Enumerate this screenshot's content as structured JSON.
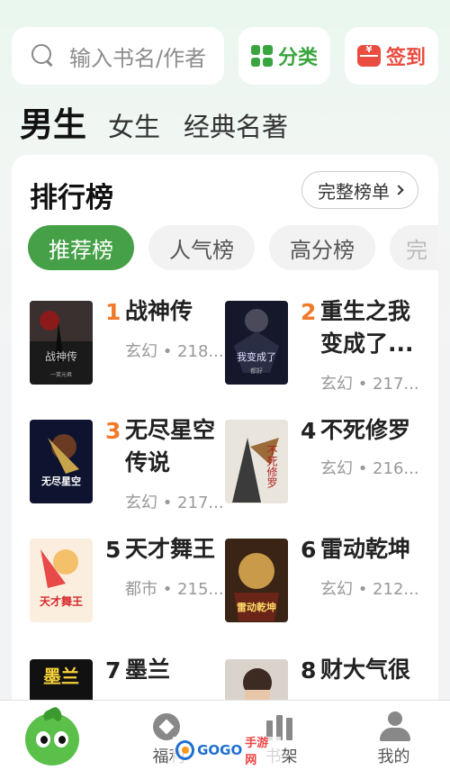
{
  "search": {
    "placeholder": "输入书名/作者"
  },
  "topbar": {
    "category_label": "分类",
    "signin_label": "签到",
    "signin_icon_glyph": "¥"
  },
  "categories": [
    {
      "label": "男生",
      "active": true
    },
    {
      "label": "女生",
      "active": false
    },
    {
      "label": "经典名著",
      "active": false
    }
  ],
  "rankings": {
    "title": "排行榜",
    "full_list_label": "完整榜单",
    "tabs": [
      {
        "label": "推荐榜",
        "active": true
      },
      {
        "label": "人气榜",
        "active": false
      },
      {
        "label": "高分榜",
        "active": false
      },
      {
        "label": "完",
        "active": false
      }
    ],
    "books": [
      {
        "rank": "1",
        "title": "战神传",
        "meta": "玄幻 • 218...",
        "cover_text": "战神传",
        "cover_sub": "一笑元君"
      },
      {
        "rank": "2",
        "title": "重生之我变成了...",
        "meta": "玄幻 • 217...",
        "cover_text": "我变成了",
        "cover_sub": "都好"
      },
      {
        "rank": "3",
        "title": "无尽星空传说",
        "meta": "玄幻 • 217...",
        "cover_text": "无尽星空",
        "cover_sub": ""
      },
      {
        "rank": "4",
        "title": "不死修罗",
        "meta": "玄幻 • 216...",
        "cover_text": "不死修罗",
        "cover_sub": ""
      },
      {
        "rank": "5",
        "title": "天才舞王",
        "meta": "都市 • 215...",
        "cover_text": "天才舞王",
        "cover_sub": ""
      },
      {
        "rank": "6",
        "title": "雷动乾坤",
        "meta": "玄幻 • 212...",
        "cover_text": "雷动乾坤",
        "cover_sub": ""
      },
      {
        "rank": "7",
        "title": "墨兰",
        "meta": "",
        "cover_text": "墨兰",
        "cover_sub": ""
      },
      {
        "rank": "8",
        "title": "财大气很",
        "meta": "",
        "cover_text": "",
        "cover_sub": ""
      }
    ]
  },
  "bottom_nav": [
    {
      "label": "",
      "icon": "mascot-icon"
    },
    {
      "label": "福利",
      "icon": "diamond-icon"
    },
    {
      "label": "书架",
      "icon": "bookshelf-icon"
    },
    {
      "label": "我的",
      "icon": "profile-icon"
    }
  ],
  "watermark": {
    "text": "GOGO",
    "text2": "手游网"
  },
  "colors": {
    "accent": "#45a047",
    "signin": "#ea4c3f",
    "top_rank": "#f07a2a"
  }
}
